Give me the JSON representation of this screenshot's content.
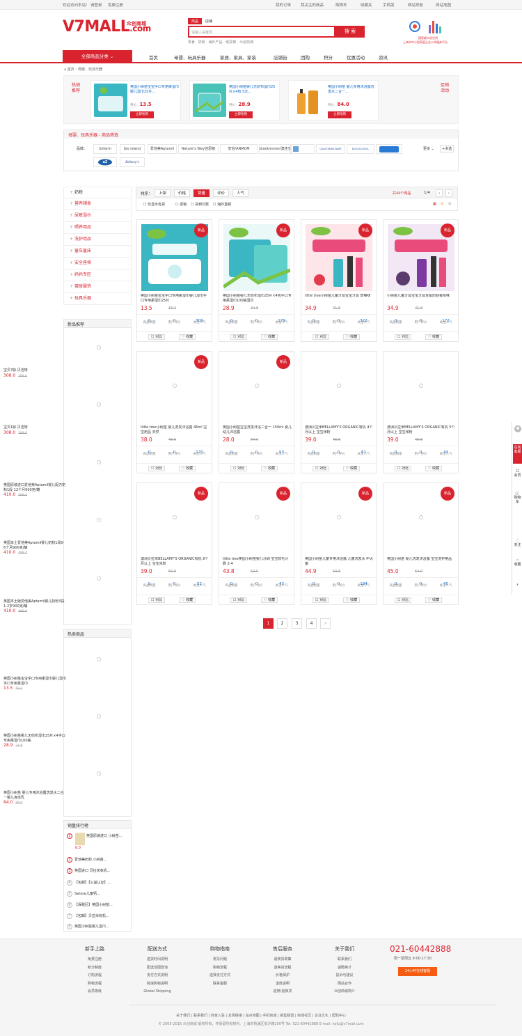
{
  "topbar": {
    "left": [
      "欢迎访问本站!",
      "请登录",
      "免费注册"
    ],
    "right": [
      "我的订单",
      "我关注的商品",
      "购物车",
      "收藏夹",
      "手机版",
      "网站导航",
      "网站地图"
    ]
  },
  "header": {
    "logo": "V7MALL",
    "logo_suffix": ".com",
    "logo_cn": "众创商城",
    "search_tabs": [
      "商品",
      "店铺"
    ],
    "search_placeholder": "请输入关键词",
    "search_button": "搜 索",
    "hot_words": "零食 · 奶粉 · 海外产品 · 纸尿裤 · 众创商城",
    "badge_line1": "国家级众创空间",
    "badge_line2": "上海市中小型家庭企业公共服务平台"
  },
  "nav": {
    "all_categories": "全部商品分类",
    "items": [
      "首页",
      "母婴、玩具乐器",
      "家居、家具、家装",
      "店铺街",
      "团购",
      "积分",
      "优惠活动",
      "资讯"
    ]
  },
  "breadcrumb": "首页 › 母婴、玩具乐器",
  "recommend": {
    "left_label": "热销推荐",
    "right_label": "促销活动",
    "items": [
      {
        "title": "英国小树苗宝宝手口专用柔湿巾婴儿湿巾25片...",
        "price_label": "特价：",
        "price": "13.5",
        "button": "立即抢购",
        "color": "#3bb7c4"
      },
      {
        "title": "英国小树苗婴儿无纺布湿巾25片×4包 5次...",
        "price_label": "特价：",
        "price": "28.9",
        "button": "立即抢购",
        "color": "#49c2b8"
      },
      {
        "title": "英国小树苗 婴儿专用沐浴露洗发水二合一...",
        "price_label": "特价：",
        "price": "84.0",
        "button": "立即抢购",
        "color": "#f0a030"
      }
    ]
  },
  "filter": {
    "title": "母婴、玩具乐器 - 商品筛选",
    "brand_label": "品牌：",
    "brands": [
      "Uzfarm",
      "bio island",
      "爱他美Aptamil",
      "Nature's Way佳思敏",
      "安怡/ANMUM",
      "blackmores/澳佳宝",
      "",
      "CALIFORNIA BABY",
      "KOOLSCHOOL",
      "",
      "a2",
      "Bellamy's"
    ],
    "more": "更多",
    "multi": "+多选"
  },
  "sidebar": {
    "categories": [
      "奶粉",
      "营养辅食",
      "尿裤湿巾",
      "喂养用品",
      "洗护用品",
      "童车童床",
      "安全座椅",
      "妈妈专区",
      "寝居服饰",
      "玩具乐器"
    ],
    "new_title": "新品推荐",
    "new_items": [
      {
        "title": "宝贝7龄 贝洁特",
        "price": "308.0",
        "old": "389.0"
      },
      {
        "title": "宝贝1龄 贝洁特",
        "price": "308.0",
        "old": "389.0"
      },
      {
        "title": "英国原装进口爱他美Aptamil婴儿配方奶粉1段 12个月900克/罐",
        "price": "410.0",
        "old": "498.0"
      },
      {
        "title": "英国本土爱他美Aptamil婴儿奶粉1段0-6个月900克/罐",
        "price": "410.0",
        "old": "498.0"
      },
      {
        "title": "英国本土版爱他美Aptamil婴儿奶粉3段1-2岁900克/罐",
        "price": "410.0",
        "old": "498.0"
      }
    ],
    "hot_title": "热卖商品",
    "hot_items": [
      {
        "title": "英国小树苗宝宝手口专用柔湿巾婴儿湿巾手口专用柔湿巾",
        "price": "13.5",
        "old": "19.2"
      },
      {
        "title": "英国小树苗婴儿无纺布湿巾25片×4手口专用柔湿巾100抽",
        "price": "28.9",
        "old": "34.8"
      },
      {
        "title": "英国小树苗 婴儿专用沐浴露洗发水二合一婴儿身体乳",
        "price": "84.0",
        "old": "98.0"
      }
    ],
    "rank_title": "销量排行榜",
    "rank": [
      {
        "n": "1",
        "t": "英国原装进口 小树苗..."
      },
      {
        "n": "2",
        "t": "爱他美奶粉 小树苗..."
      },
      {
        "n": "3",
        "t": "英国进口 贝拉米有机..."
      },
      {
        "n": "4",
        "t": "【包邮】【公益认证】..."
      },
      {
        "n": "5",
        "t": "Swisse儿童钙..."
      },
      {
        "n": "6",
        "t": "【保税区】英国小树苗..."
      },
      {
        "n": "7",
        "t": "【包邮】贝拉米有机..."
      },
      {
        "n": "8",
        "t": "英国小树苗婴儿湿巾..."
      }
    ],
    "rank_first_price": "6.0"
  },
  "sort": {
    "label": "排序：",
    "buttons": [
      "上架",
      "价格",
      "销量",
      "评价",
      "人气"
    ],
    "active": 2,
    "count": "共44个商品",
    "pages": "1/4",
    "sub": [
      "仅显示有货",
      "促销",
      "货到付款",
      "海外直邮"
    ]
  },
  "products": [
    {
      "title": "英国小树苗宝宝手口专用柔湿巾婴儿湿巾手口专用柔湿巾25片",
      "price": "13.5",
      "old": "16.2",
      "sales": "0",
      "reviews": "0",
      "fav": "309",
      "new": true,
      "img": "wipes1"
    },
    {
      "title": "英国小树苗婴儿无纺布湿巾25片×4包手口专用柔湿巾100抽湿巾",
      "price": "28.9",
      "old": "34.8",
      "sales": "0",
      "reviews": "0",
      "fav": "179",
      "new": true,
      "img": "wipes2"
    },
    {
      "title": "little tree小树苗儿童牙膏宝宝牙膏 草莓味",
      "price": "34.9",
      "old": "41.8",
      "sales": "0",
      "reviews": "0",
      "fav": "322",
      "new": true,
      "img": "tooth1"
    },
    {
      "title": "小树苗儿童牙膏宝宝牙膏含氟防蛀葡萄味",
      "price": "34.9",
      "old": "41.8",
      "sales": "0",
      "reviews": "0",
      "fav": "172",
      "new": true,
      "img": "tooth2"
    },
    {
      "title": "little tree小树苗 婴儿洗发沐浴露 46ml 宝宝用品 天然",
      "price": "38.0",
      "old": "45.6",
      "sales": "0",
      "reviews": "0",
      "fav": "170",
      "new": true,
      "img": ""
    },
    {
      "title": "英国小树苗宝宝洗发沐浴二合一 150ml 婴儿幼儿沐浴露",
      "price": "28.0",
      "old": "34.0",
      "sales": "0",
      "reviews": "0",
      "fav": "53",
      "new": true,
      "img": ""
    },
    {
      "title": "澳洲贝拉米BELLAMY'S ORGANIC有机 4个月以上 宝宝米粉",
      "price": "39.0",
      "old": "46.8",
      "sales": "0",
      "reviews": "0",
      "fav": "61",
      "new": false,
      "img": ""
    },
    {
      "title": "澳洲贝拉米BELLAMY'S ORGANIC有机 5个月以上 宝宝米粉",
      "price": "39.0",
      "old": "46.8",
      "sales": "0",
      "reviews": "0",
      "fav": "44",
      "new": false,
      "img": ""
    },
    {
      "title": "澳洲贝拉米BELLAMY'S ORGANIC有机 8个月以上 宝宝米粉",
      "price": "39.0",
      "old": "50.0",
      "sales": "0",
      "reviews": "0",
      "fav": "52",
      "new": true,
      "img": ""
    },
    {
      "title": "little tree英国小树苗婴儿牙刷 宝宝软毛牙刷 2-4",
      "price": "43.8",
      "old": "52.5",
      "sales": "0",
      "reviews": "0",
      "fav": "43",
      "new": true,
      "img": ""
    },
    {
      "title": "英国小树苗儿童专用沐浴露 儿童洗发水 中大童",
      "price": "44.9",
      "old": "53.8",
      "sales": "0",
      "reviews": "0",
      "fav": "194",
      "new": true,
      "img": ""
    },
    {
      "title": "英国小树苗 婴儿洗发沐浴露 宝宝洗护用品",
      "price": "45.0",
      "old": "54.0",
      "sales": "0",
      "reviews": "0",
      "fav": "45",
      "new": true,
      "img": ""
    }
  ],
  "card_labels": {
    "new": "新品",
    "sales": "商品销量",
    "reviews": "用户评价",
    "fav": "关注人气",
    "compare": "对比",
    "collect": "收藏"
  },
  "pager": [
    "1",
    "2",
    "3",
    "4",
    ">"
  ],
  "footer": {
    "cols": [
      {
        "h": "新手上路",
        "l": [
          "免费注册",
          "积分制度",
          "订购流程",
          "购物流程",
          "会员等级"
        ]
      },
      {
        "h": "配送方式",
        "l": [
          "送货时间说明",
          "配送范围查询",
          "支付方式说明",
          "跨境购物说明",
          "Global Shipping"
        ]
      },
      {
        "h": "购物指南",
        "l": [
          "常见问题",
          "购物流程",
          "选择支付方式",
          "联系客服"
        ]
      },
      {
        "h": "售后服务",
        "l": [
          "退换货政策",
          "退换货流程",
          "价格保护",
          "退款说明",
          "返修/退换货"
        ]
      },
      {
        "h": "关于我们",
        "l": [
          "联系我们",
          "诚聘英才",
          "投诉与建议",
          "网站合作",
          "众创商城简介"
        ]
      }
    ],
    "phone": "021-60442888",
    "hours": "周一至周五 9:00-17:30",
    "cs_button": "24小时在线客服",
    "links": "关于我们 | 联系我们 | 商家入驻 | 友情链接 | 站点地图 | 手机商城 | 销售联盟 | 商城社区 | 企业文化 | 帮助中心",
    "copyright": "© 2005-2016 众创商城 版权所有，并保留所有权利。上海市杨浦区淞沪路200号 Tel: 021-60442888 E-mail: kefu@v7mall.com"
  },
  "rightbar": [
    "在线客服",
    "会员",
    "购物车",
    "关注",
    "收藏",
    "顶部"
  ]
}
